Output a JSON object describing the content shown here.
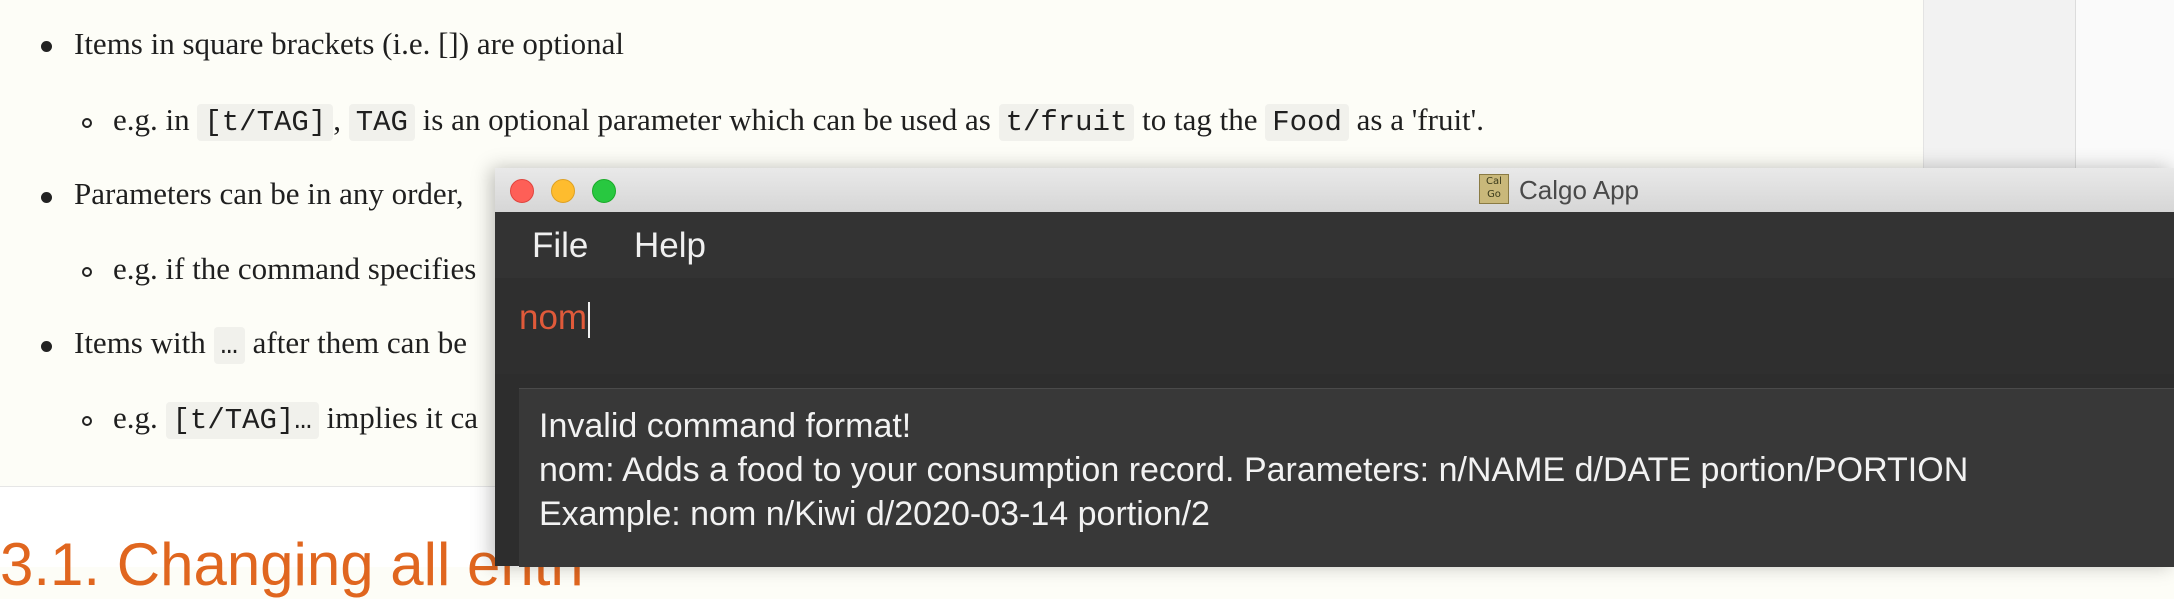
{
  "doc": {
    "bullet1": "Items in square brackets (i.e. []) are optional",
    "sub1": {
      "prefix": "e.g. in",
      "code1": "[t/TAG]",
      "sep": ",",
      "code2": "TAG",
      "mid": "is an optional parameter which can be used as",
      "code3": "t/fruit",
      "mid2": "to tag the",
      "code4": "Food",
      "suffix": "as a 'fruit'."
    },
    "bullet2": "Parameters can be in any order,",
    "sub2": "e.g. if the command specifies",
    "bullet3": {
      "prefix": "Items with",
      "code": "…",
      "suffix": "after them can be"
    },
    "sub3": {
      "prefix": "e.g.",
      "code": "[t/TAG]…",
      "suffix": "implies it ca"
    },
    "heading": "3.1. Changing all entri"
  },
  "app": {
    "title": "Calgo App",
    "icon_text": "Cal Go",
    "menu": [
      "File",
      "Help"
    ],
    "command_input": "nom",
    "result_lines": [
      "Invalid command format!",
      "nom: Adds a food to your consumption record. Parameters: n/NAME d/DATE portion/PORTION",
      "Example: nom n/Kiwi d/2020-03-14 portion/2"
    ]
  },
  "colors": {
    "heading": "#e0661f",
    "command_text": "#e05a3a",
    "app_background": "#2d2d2d",
    "close": "#fe5f57",
    "minimize": "#febc2e",
    "maximize": "#28c840"
  }
}
